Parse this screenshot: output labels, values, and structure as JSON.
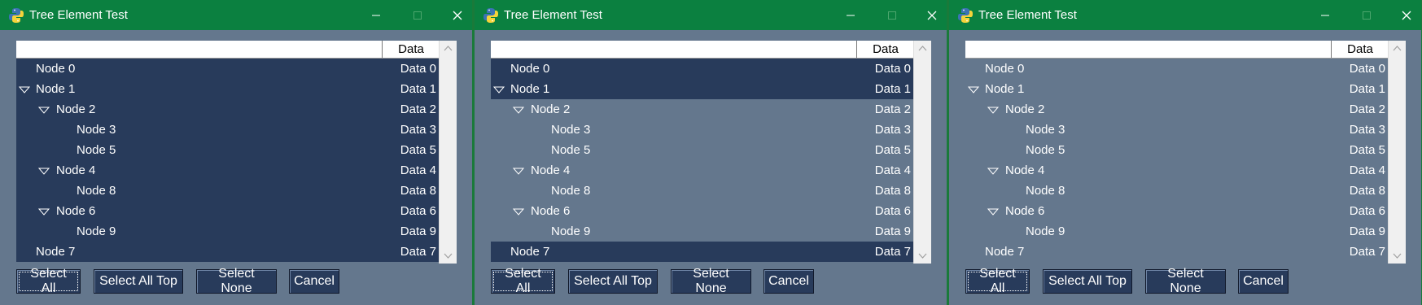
{
  "window_title": "Tree Element Test",
  "header": {
    "data_label": "Data"
  },
  "nodes": [
    {
      "label": "Node 0",
      "data": "Data 0"
    },
    {
      "label": "Node 1",
      "data": "Data 1"
    },
    {
      "label": "Node 2",
      "data": "Data 2"
    },
    {
      "label": "Node 3",
      "data": "Data 3"
    },
    {
      "label": "Node 5",
      "data": "Data 5"
    },
    {
      "label": "Node 4",
      "data": "Data 4"
    },
    {
      "label": "Node 8",
      "data": "Data 8"
    },
    {
      "label": "Node 6",
      "data": "Data 6"
    },
    {
      "label": "Node 9",
      "data": "Data 9"
    },
    {
      "label": "Node 7",
      "data": "Data 7"
    }
  ],
  "buttons": {
    "select_all": "Select All",
    "select_all_top": "Select All Top",
    "select_none": "Select None",
    "cancel": "Cancel"
  },
  "colors": {
    "titlebar": "#0b8040",
    "window_bg": "#64778d",
    "selected_row": "#283b5b",
    "button_bg": "#283b5b"
  },
  "windows": [
    {
      "state": "all-selected"
    },
    {
      "state": "top-selected"
    },
    {
      "state": "none-selected"
    }
  ]
}
